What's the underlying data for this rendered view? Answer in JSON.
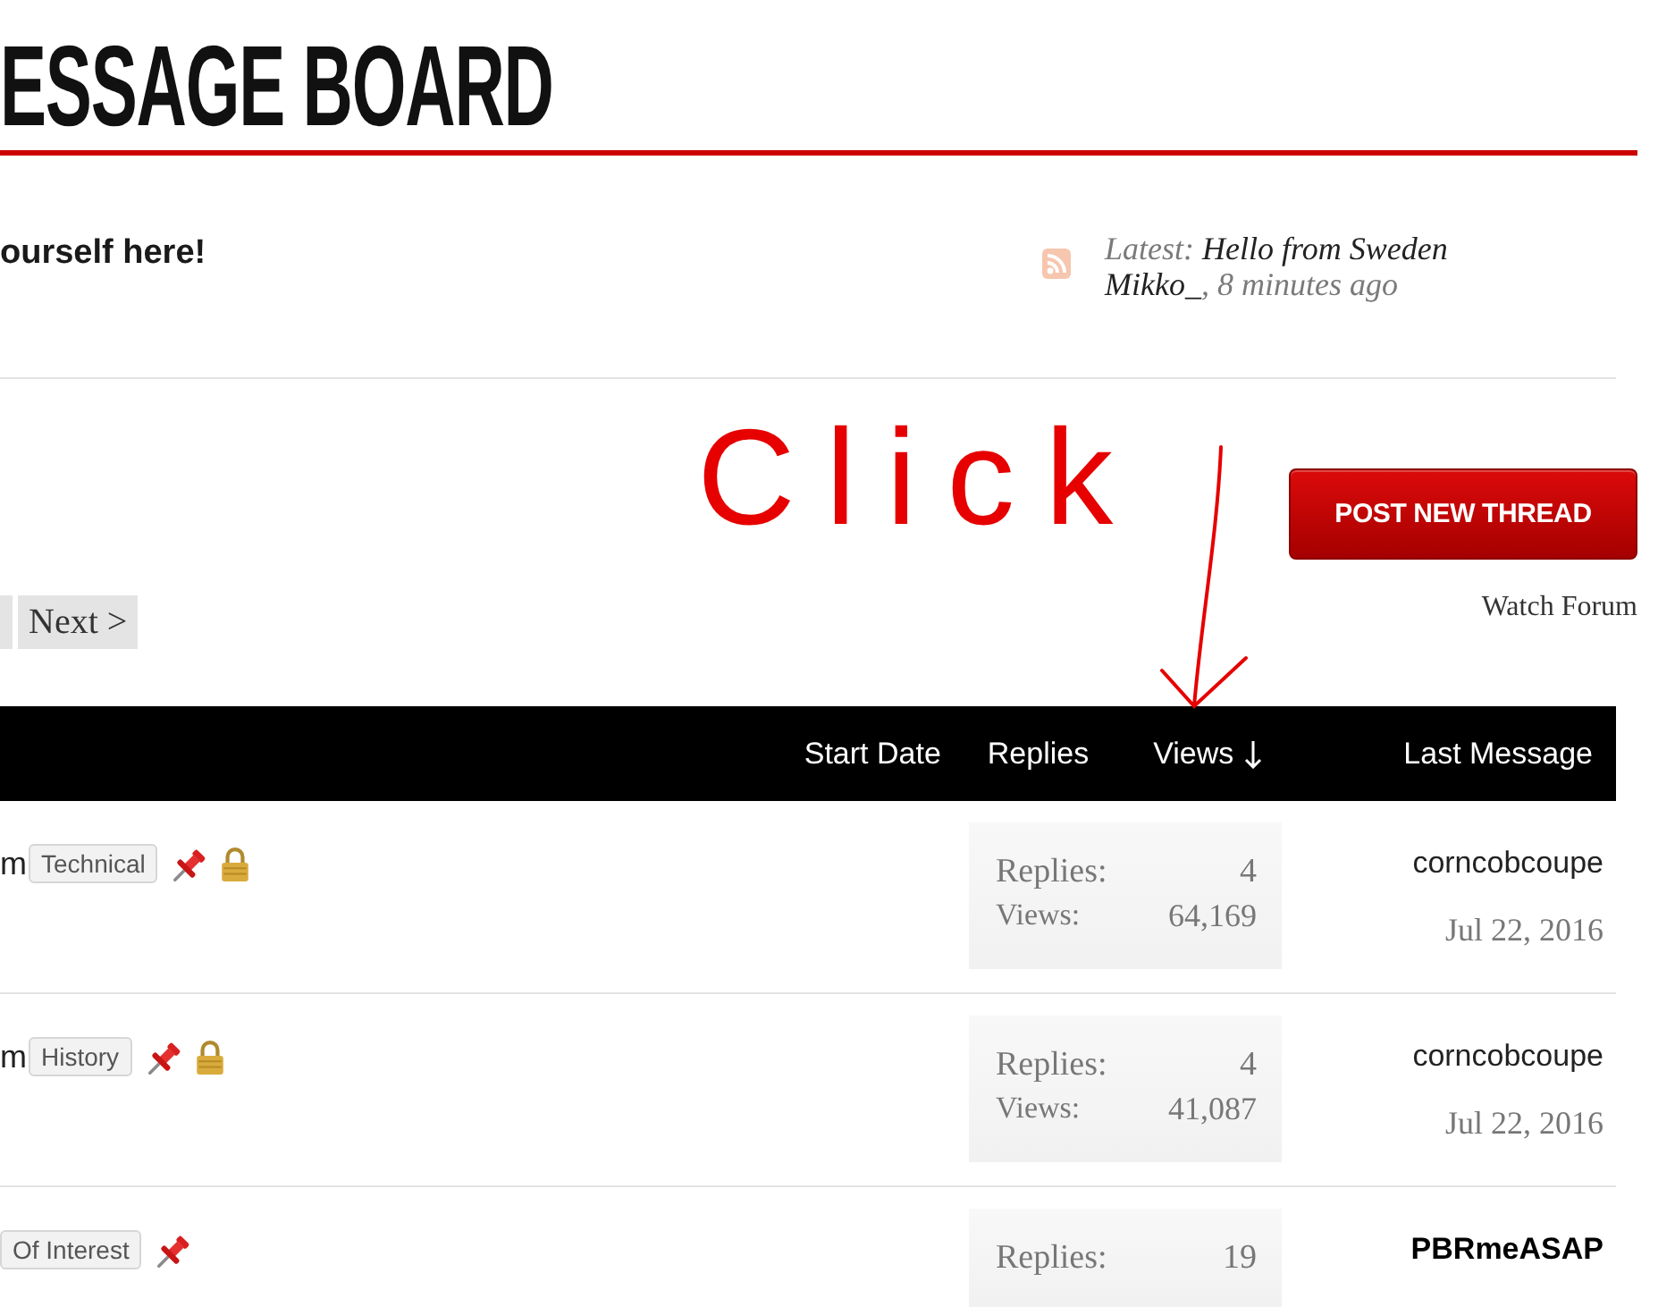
{
  "page_title": "ESSAGE BOARD",
  "forum": {
    "description": "ourself here!",
    "latest": {
      "label": "Latest:",
      "thread": "Hello from Sweden",
      "author": "Mikko_",
      "time": ", 8 minutes ago"
    }
  },
  "pagination": {
    "next": "Next >"
  },
  "actions": {
    "post_button": "POST NEW THREAD",
    "watch_link": "Watch Forum"
  },
  "annotation": {
    "text": "Click"
  },
  "table": {
    "columns": [
      {
        "label": "Start Date",
        "sorted": false
      },
      {
        "label": "Replies",
        "sorted": false
      },
      {
        "label": "Views",
        "sorted": true
      },
      {
        "label": "Last Message",
        "sorted": false
      }
    ],
    "rows": [
      {
        "title": "m",
        "tag": "Technical",
        "pinned": true,
        "locked": true,
        "stats": [
          {
            "label": "Replies:",
            "value": "4"
          },
          {
            "label": "Views:",
            "value": "64,169"
          }
        ],
        "last_poster": "corncobcoupe",
        "last_date": "Jul 22, 2016",
        "emphasized": false
      },
      {
        "title": "m",
        "tag": "History",
        "pinned": true,
        "locked": true,
        "stats": [
          {
            "label": "Replies:",
            "value": "4"
          },
          {
            "label": "Views:",
            "value": "41,087"
          }
        ],
        "last_poster": "corncobcoupe",
        "last_date": "Jul 22, 2016",
        "emphasized": false
      },
      {
        "tag": "Of Interest",
        "pinned": true,
        "locked": false,
        "stats": [
          {
            "label": "Replies:",
            "value": "19"
          }
        ],
        "last_poster": "PBRmeASAP",
        "emphasized": true
      }
    ]
  }
}
